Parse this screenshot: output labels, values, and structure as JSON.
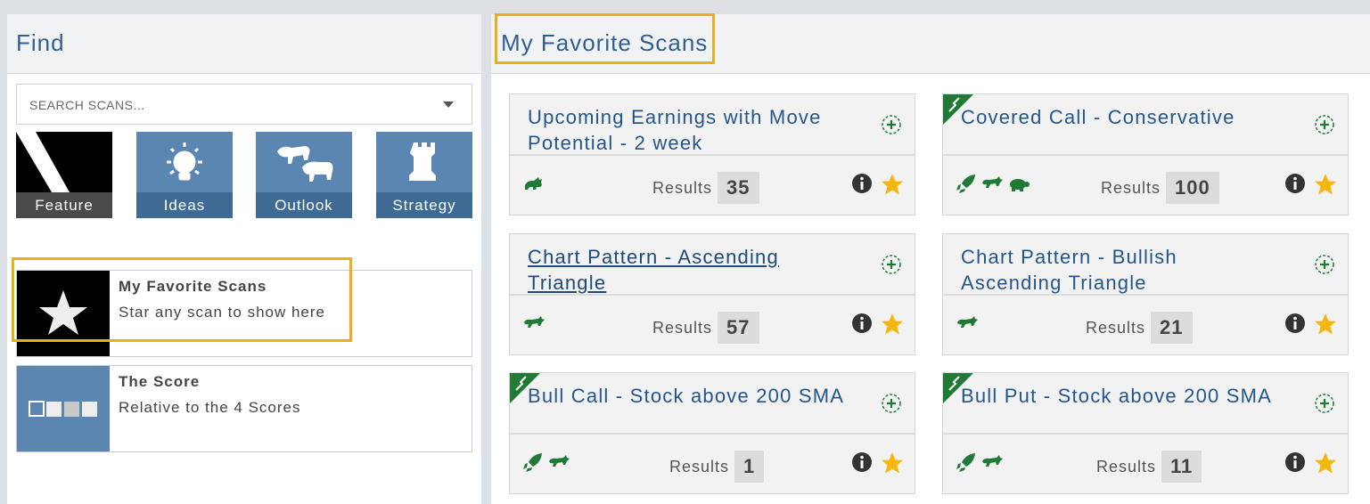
{
  "find": {
    "title": "Find",
    "search_placeholder": "SEARCH SCANS...",
    "tiles": [
      {
        "label": "Feature",
        "icon": "spotlight-icon"
      },
      {
        "label": "Ideas",
        "icon": "lightbulb-icon"
      },
      {
        "label": "Outlook",
        "icon": "bull-bear-icon"
      },
      {
        "label": "Strategy",
        "icon": "chess-rook-icon"
      }
    ],
    "cards": [
      {
        "title": "My Favorite Scans",
        "subtitle": "Star any scan to show here",
        "icon": "star-icon"
      },
      {
        "title": "The Score",
        "subtitle": "Relative to the 4 Scores",
        "icon": "score-boxes-icon"
      }
    ]
  },
  "favorites": {
    "title": "My Favorite Scans",
    "results_label": "Results",
    "scans": [
      {
        "name": "Upcoming Earnings with Move Potential - 2 week",
        "results": "35",
        "icons": [
          "rabbit-icon"
        ],
        "corner": false,
        "underline": false
      },
      {
        "name": "Covered Call - Conservative",
        "results": "100",
        "icons": [
          "rocket-icon",
          "bull-icon",
          "turtle-icon"
        ],
        "corner": true,
        "underline": false
      },
      {
        "name": "Chart Pattern - Ascending Triangle",
        "results": "57",
        "icons": [
          "bull-icon"
        ],
        "corner": false,
        "underline": true
      },
      {
        "name": "Chart Pattern - Bullish Ascending Triangle",
        "results": "21",
        "icons": [
          "bull-icon"
        ],
        "corner": false,
        "underline": false
      },
      {
        "name": "Bull Call - Stock above 200 SMA",
        "results": "1",
        "icons": [
          "rocket-icon",
          "bull-icon"
        ],
        "corner": true,
        "underline": false
      },
      {
        "name": "Bull Put - Stock above 200 SMA",
        "results": "11",
        "icons": [
          "rocket-icon",
          "bull-icon"
        ],
        "corner": true,
        "underline": false
      }
    ]
  },
  "colors": {
    "accent": "#2f5f93",
    "highlight": "#f0ad1b",
    "green": "#1f7a36",
    "star": "#f5b60e"
  }
}
